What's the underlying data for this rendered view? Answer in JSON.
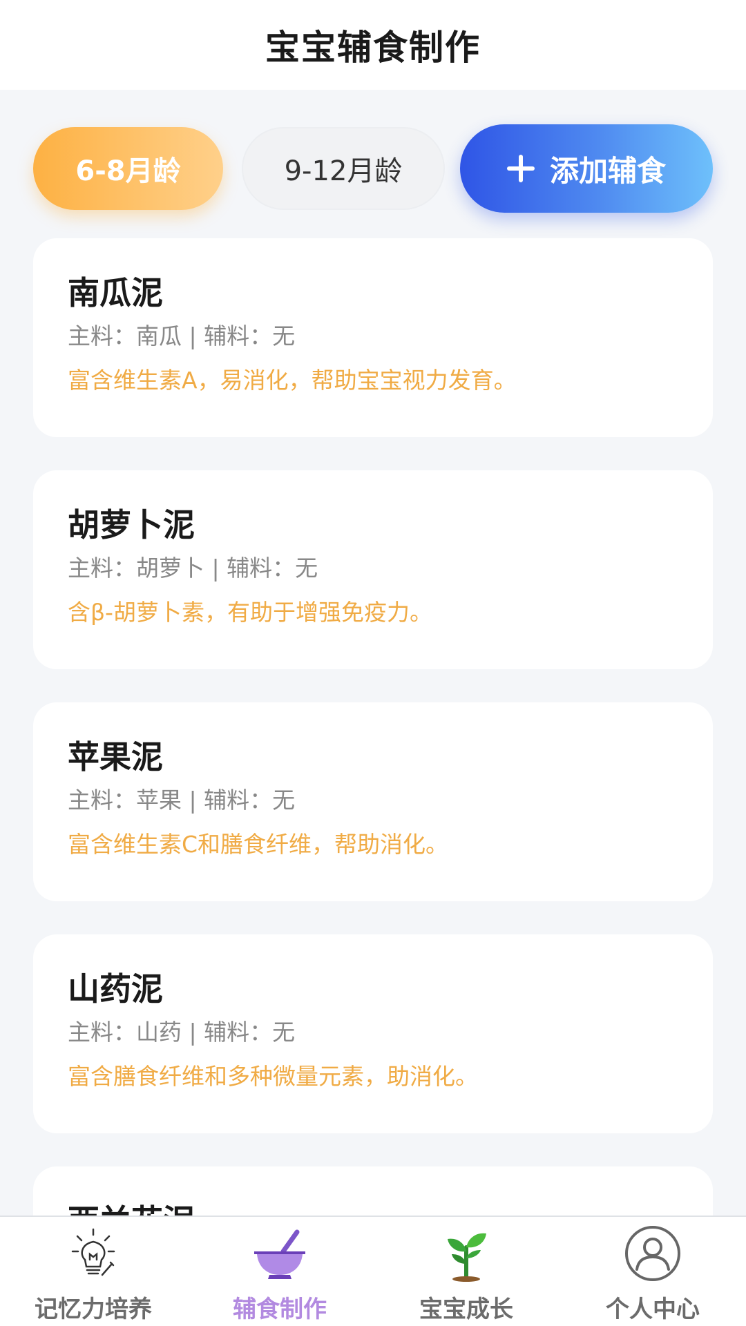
{
  "header": {
    "title": "宝宝辅食制作"
  },
  "filters": {
    "age_6_8": "6-8月龄",
    "age_9_12": "9-12月龄",
    "add_label": "添加辅食"
  },
  "recipes": [
    {
      "name": "南瓜泥",
      "ingredients": "主料：南瓜 | 辅料：无",
      "desc": "富含维生素A，易消化，帮助宝宝视力发育。"
    },
    {
      "name": "胡萝卜泥",
      "ingredients": "主料：胡萝卜 | 辅料：无",
      "desc": "含β-胡萝卜素，有助于增强免疫力。"
    },
    {
      "name": "苹果泥",
      "ingredients": "主料：苹果 | 辅料：无",
      "desc": "富含维生素C和膳食纤维，帮助消化。"
    },
    {
      "name": "山药泥",
      "ingredients": "主料：山药 | 辅料：无",
      "desc": "富含膳食纤维和多种微量元素，助消化。"
    },
    {
      "name": "西兰花泥",
      "ingredients": "",
      "desc": ""
    }
  ],
  "nav": {
    "memory": "记忆力培养",
    "food": "辅食制作",
    "growth": "宝宝成长",
    "profile": "个人中心"
  },
  "colors": {
    "active_chip": "#fdb143",
    "add_button": "#2f55e6",
    "desc_text": "#f0ab45",
    "nav_active": "#b28ae0"
  }
}
